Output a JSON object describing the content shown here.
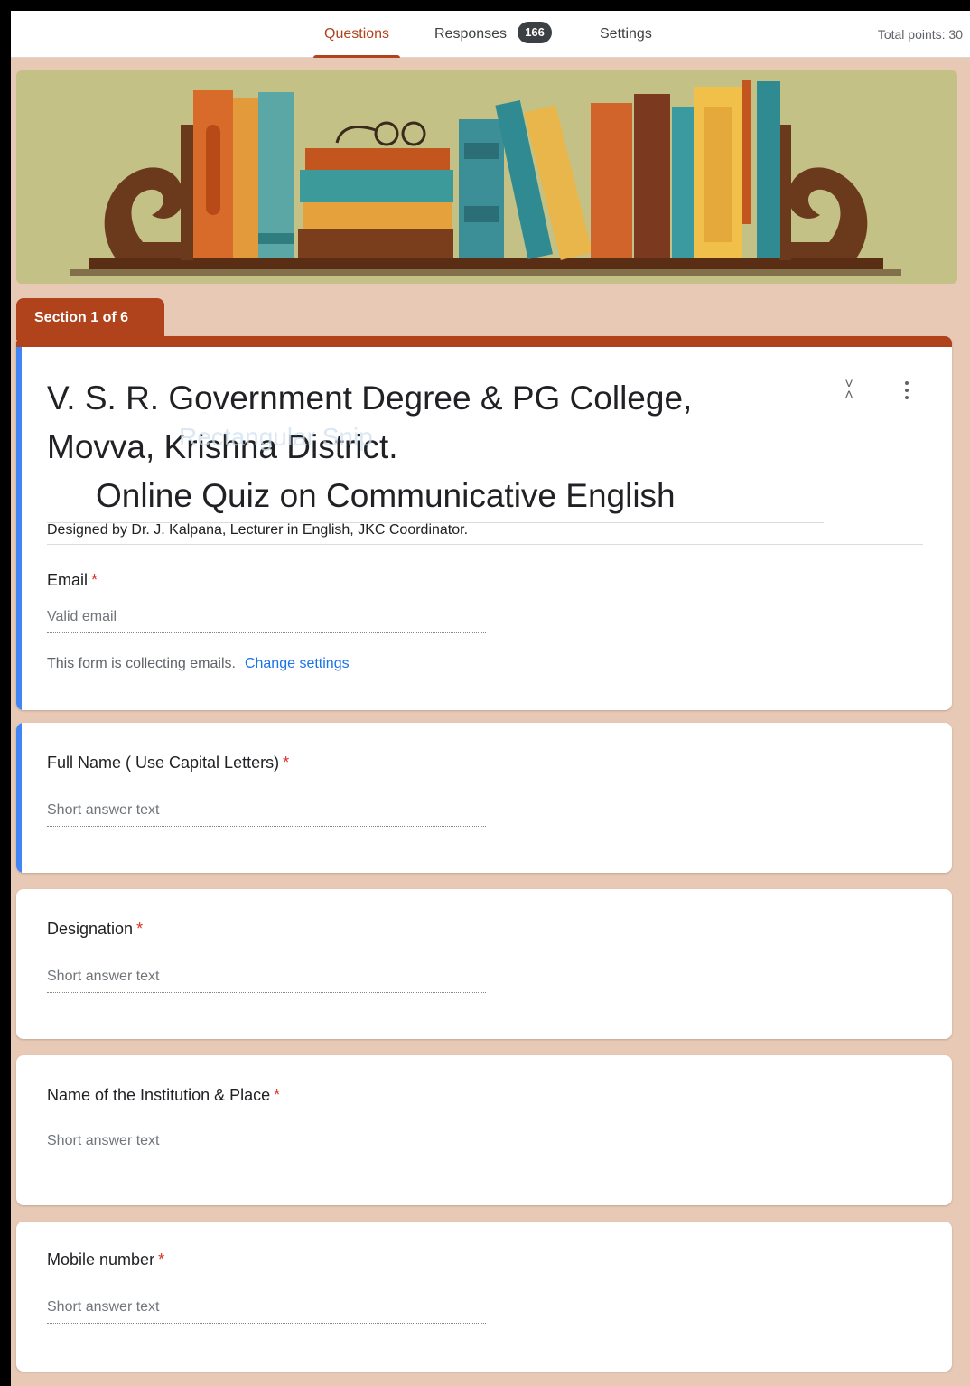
{
  "tabs": {
    "questions": "Questions",
    "responses": "Responses",
    "responses_count": "166",
    "settings": "Settings",
    "total_points": "Total points: 30"
  },
  "banner": {
    "image": "books-on-shelf-illustration"
  },
  "section": {
    "label": "Section 1 of 6"
  },
  "form": {
    "title_line1": "V. S. R. Government Degree & PG College,",
    "title_line2": "Movva, Krishna District.",
    "title_line3": "Online Quiz on Communicative English",
    "overlay_text": "Rectangular Snip",
    "description": "Designed by Dr. J. Kalpana, Lecturer in English, JKC Coordinator."
  },
  "email": {
    "label": "Email",
    "placeholder": "Valid email",
    "note": "This form is collecting emails.",
    "change_link": "Change settings"
  },
  "questions": [
    {
      "label": "Full Name ( Use Capital Letters)",
      "placeholder": "Short answer text"
    },
    {
      "label": "Designation",
      "placeholder": "Short answer text"
    },
    {
      "label": "Name of the Institution & Place",
      "placeholder": "Short answer text"
    },
    {
      "label": "Mobile number",
      "placeholder": "Short answer text"
    }
  ],
  "required_mark": "*",
  "colors": {
    "theme": "#b0431c",
    "background": "#e8c9b5",
    "focus": "#4285f4"
  },
  "icons": [
    "collapse-icon",
    "more-vert-icon"
  ]
}
